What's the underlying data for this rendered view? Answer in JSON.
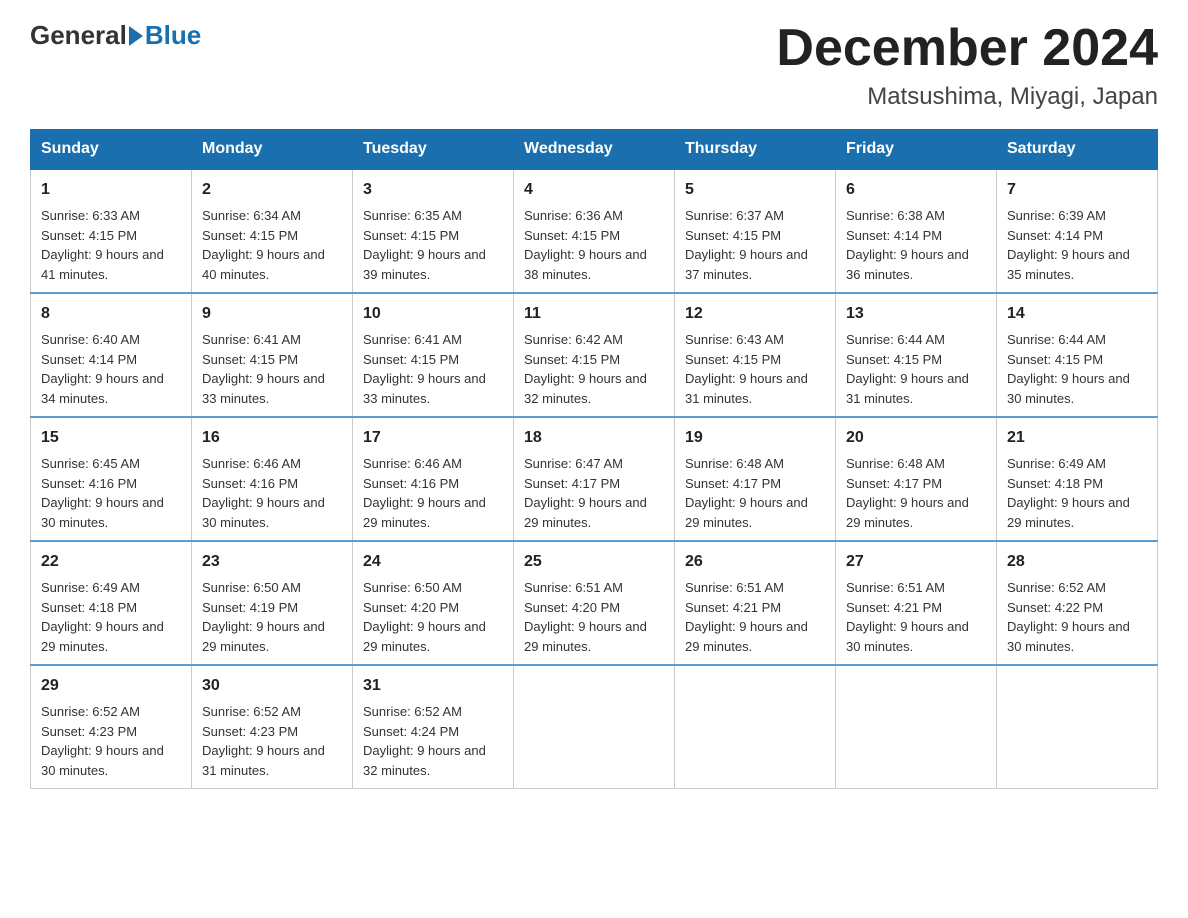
{
  "logo": {
    "general": "General",
    "blue": "Blue"
  },
  "title": "December 2024",
  "subtitle": "Matsushima, Miyagi, Japan",
  "days_of_week": [
    "Sunday",
    "Monday",
    "Tuesday",
    "Wednesday",
    "Thursday",
    "Friday",
    "Saturday"
  ],
  "weeks": [
    [
      {
        "day": "1",
        "sunrise": "6:33 AM",
        "sunset": "4:15 PM",
        "daylight": "9 hours and 41 minutes."
      },
      {
        "day": "2",
        "sunrise": "6:34 AM",
        "sunset": "4:15 PM",
        "daylight": "9 hours and 40 minutes."
      },
      {
        "day": "3",
        "sunrise": "6:35 AM",
        "sunset": "4:15 PM",
        "daylight": "9 hours and 39 minutes."
      },
      {
        "day": "4",
        "sunrise": "6:36 AM",
        "sunset": "4:15 PM",
        "daylight": "9 hours and 38 minutes."
      },
      {
        "day": "5",
        "sunrise": "6:37 AM",
        "sunset": "4:15 PM",
        "daylight": "9 hours and 37 minutes."
      },
      {
        "day": "6",
        "sunrise": "6:38 AM",
        "sunset": "4:14 PM",
        "daylight": "9 hours and 36 minutes."
      },
      {
        "day": "7",
        "sunrise": "6:39 AM",
        "sunset": "4:14 PM",
        "daylight": "9 hours and 35 minutes."
      }
    ],
    [
      {
        "day": "8",
        "sunrise": "6:40 AM",
        "sunset": "4:14 PM",
        "daylight": "9 hours and 34 minutes."
      },
      {
        "day": "9",
        "sunrise": "6:41 AM",
        "sunset": "4:15 PM",
        "daylight": "9 hours and 33 minutes."
      },
      {
        "day": "10",
        "sunrise": "6:41 AM",
        "sunset": "4:15 PM",
        "daylight": "9 hours and 33 minutes."
      },
      {
        "day": "11",
        "sunrise": "6:42 AM",
        "sunset": "4:15 PM",
        "daylight": "9 hours and 32 minutes."
      },
      {
        "day": "12",
        "sunrise": "6:43 AM",
        "sunset": "4:15 PM",
        "daylight": "9 hours and 31 minutes."
      },
      {
        "day": "13",
        "sunrise": "6:44 AM",
        "sunset": "4:15 PM",
        "daylight": "9 hours and 31 minutes."
      },
      {
        "day": "14",
        "sunrise": "6:44 AM",
        "sunset": "4:15 PM",
        "daylight": "9 hours and 30 minutes."
      }
    ],
    [
      {
        "day": "15",
        "sunrise": "6:45 AM",
        "sunset": "4:16 PM",
        "daylight": "9 hours and 30 minutes."
      },
      {
        "day": "16",
        "sunrise": "6:46 AM",
        "sunset": "4:16 PM",
        "daylight": "9 hours and 30 minutes."
      },
      {
        "day": "17",
        "sunrise": "6:46 AM",
        "sunset": "4:16 PM",
        "daylight": "9 hours and 29 minutes."
      },
      {
        "day": "18",
        "sunrise": "6:47 AM",
        "sunset": "4:17 PM",
        "daylight": "9 hours and 29 minutes."
      },
      {
        "day": "19",
        "sunrise": "6:48 AM",
        "sunset": "4:17 PM",
        "daylight": "9 hours and 29 minutes."
      },
      {
        "day": "20",
        "sunrise": "6:48 AM",
        "sunset": "4:17 PM",
        "daylight": "9 hours and 29 minutes."
      },
      {
        "day": "21",
        "sunrise": "6:49 AM",
        "sunset": "4:18 PM",
        "daylight": "9 hours and 29 minutes."
      }
    ],
    [
      {
        "day": "22",
        "sunrise": "6:49 AM",
        "sunset": "4:18 PM",
        "daylight": "9 hours and 29 minutes."
      },
      {
        "day": "23",
        "sunrise": "6:50 AM",
        "sunset": "4:19 PM",
        "daylight": "9 hours and 29 minutes."
      },
      {
        "day": "24",
        "sunrise": "6:50 AM",
        "sunset": "4:20 PM",
        "daylight": "9 hours and 29 minutes."
      },
      {
        "day": "25",
        "sunrise": "6:51 AM",
        "sunset": "4:20 PM",
        "daylight": "9 hours and 29 minutes."
      },
      {
        "day": "26",
        "sunrise": "6:51 AM",
        "sunset": "4:21 PM",
        "daylight": "9 hours and 29 minutes."
      },
      {
        "day": "27",
        "sunrise": "6:51 AM",
        "sunset": "4:21 PM",
        "daylight": "9 hours and 30 minutes."
      },
      {
        "day": "28",
        "sunrise": "6:52 AM",
        "sunset": "4:22 PM",
        "daylight": "9 hours and 30 minutes."
      }
    ],
    [
      {
        "day": "29",
        "sunrise": "6:52 AM",
        "sunset": "4:23 PM",
        "daylight": "9 hours and 30 minutes."
      },
      {
        "day": "30",
        "sunrise": "6:52 AM",
        "sunset": "4:23 PM",
        "daylight": "9 hours and 31 minutes."
      },
      {
        "day": "31",
        "sunrise": "6:52 AM",
        "sunset": "4:24 PM",
        "daylight": "9 hours and 32 minutes."
      },
      null,
      null,
      null,
      null
    ]
  ]
}
